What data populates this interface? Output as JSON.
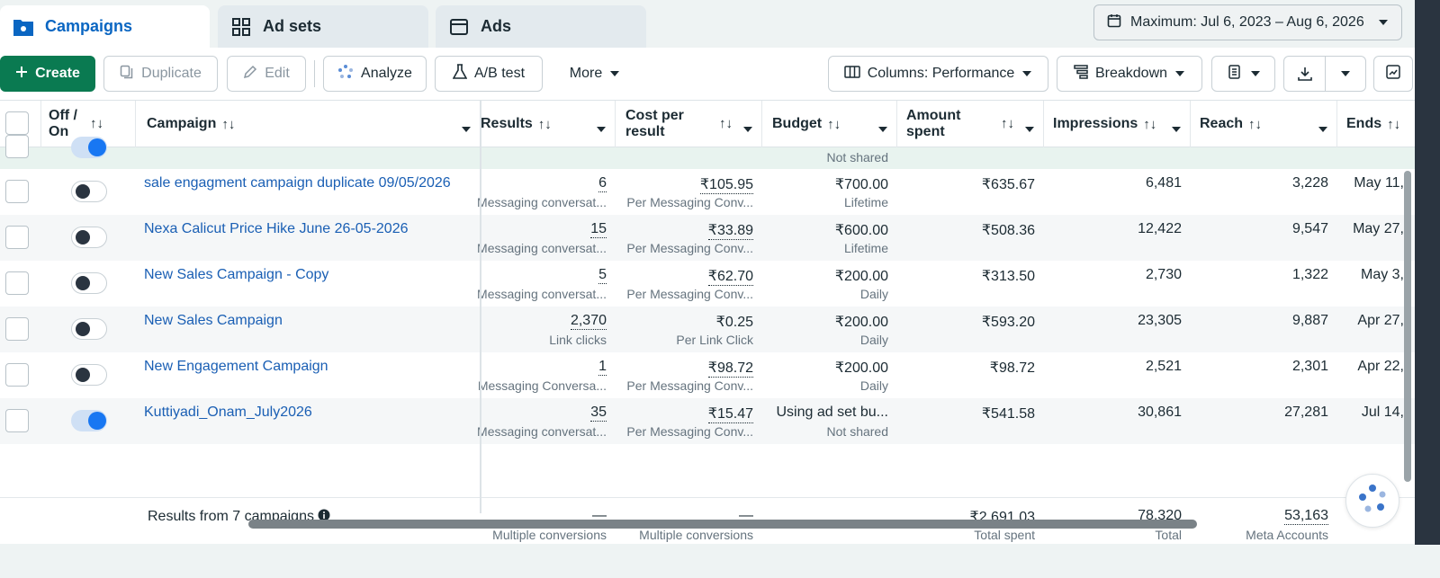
{
  "tabs": [
    {
      "label": "Campaigns",
      "icon": "folder-icon",
      "active": true
    },
    {
      "label": "Ad sets",
      "icon": "grid-icon",
      "active": false
    },
    {
      "label": "Ads",
      "icon": "ad-window-icon",
      "active": false
    }
  ],
  "date_range": "Maximum: Jul 6, 2023 – Aug 6, 2026",
  "toolbar": {
    "create": "Create",
    "duplicate": "Duplicate",
    "edit": "Edit",
    "analyze": "Analyze",
    "ab_test": "A/B test",
    "more": "More",
    "columns": "Columns: Performance",
    "breakdown": "Breakdown"
  },
  "columns": {
    "off_on_line1": "Off /",
    "off_on_line2": "On",
    "campaign": "Campaign",
    "results": "Results",
    "cost_line1": "Cost per",
    "cost_line2": "result",
    "budget": "Budget",
    "amount_line1": "Amount",
    "amount_line2": "spent",
    "impressions": "Impressions",
    "reach": "Reach",
    "ends": "Ends"
  },
  "sort_glyph": "↑↓",
  "partial_row": {
    "budget_sub": "Not shared"
  },
  "rows": [
    {
      "campaign": "sale engagment campaign duplicate 09/05/2026",
      "on": false,
      "results": "6",
      "results_sub": "Messaging conversat...",
      "cost": "₹105.95",
      "cost_sub": "Per Messaging Conv...",
      "budget": "₹700.00",
      "budget_sub": "Lifetime",
      "spent": "₹635.67",
      "impressions": "6,481",
      "reach": "3,228",
      "ends": "May 11,"
    },
    {
      "campaign": "Nexa Calicut Price Hike June 26-05-2026",
      "on": false,
      "results": "15",
      "results_sub": "Messaging conversat...",
      "cost": "₹33.89",
      "cost_sub": "Per Messaging Conv...",
      "budget": "₹600.00",
      "budget_sub": "Lifetime",
      "spent": "₹508.36",
      "impressions": "12,422",
      "reach": "9,547",
      "ends": "May 27,"
    },
    {
      "campaign": "New Sales Campaign - Copy",
      "on": false,
      "results": "5",
      "results_sub": "Messaging conversat...",
      "cost": "₹62.70",
      "cost_sub": "Per Messaging Conv...",
      "budget": "₹200.00",
      "budget_sub": "Daily",
      "spent": "₹313.50",
      "impressions": "2,730",
      "reach": "1,322",
      "ends": "May 3,"
    },
    {
      "campaign": "New Sales Campaign",
      "on": false,
      "results": "2,370",
      "results_sub": "Link clicks",
      "cost": "₹0.25",
      "cost_sub": "Per Link Click",
      "budget": "₹200.00",
      "budget_sub": "Daily",
      "spent": "₹593.20",
      "impressions": "23,305",
      "reach": "9,887",
      "ends": "Apr 27,"
    },
    {
      "campaign": "New Engagement Campaign",
      "on": false,
      "results": "1",
      "results_sub": "Messaging Conversa...",
      "cost": "₹98.72",
      "cost_sub": "Per Messaging Conv...",
      "budget": "₹200.00",
      "budget_sub": "Daily",
      "spent": "₹98.72",
      "impressions": "2,521",
      "reach": "2,301",
      "ends": "Apr 22,"
    },
    {
      "campaign": "Kuttiyadi_Onam_July2026",
      "on": true,
      "results": "35",
      "results_sub": "Messaging conversat...",
      "cost": "₹15.47",
      "cost_sub": "Per Messaging Conv...",
      "budget": "Using ad set bu...",
      "budget_sub": "Not shared",
      "spent": "₹541.58",
      "impressions": "30,861",
      "reach": "27,281",
      "ends": "Jul 14,"
    }
  ],
  "summary": {
    "label": "Results from 7 campaigns",
    "results": "—",
    "results_sub": "Multiple conversions",
    "cost": "—",
    "cost_sub": "Multiple conversions",
    "spent": "₹2,691.03",
    "spent_sub": "Total spent",
    "impressions": "78,320",
    "impressions_sub": "Total",
    "reach": "53,163",
    "reach_sub": "Meta Accounts"
  },
  "colors": {
    "primary_green": "#0a7a51",
    "link_blue": "#1a5fb4",
    "toggle_on": "#1877f2"
  }
}
